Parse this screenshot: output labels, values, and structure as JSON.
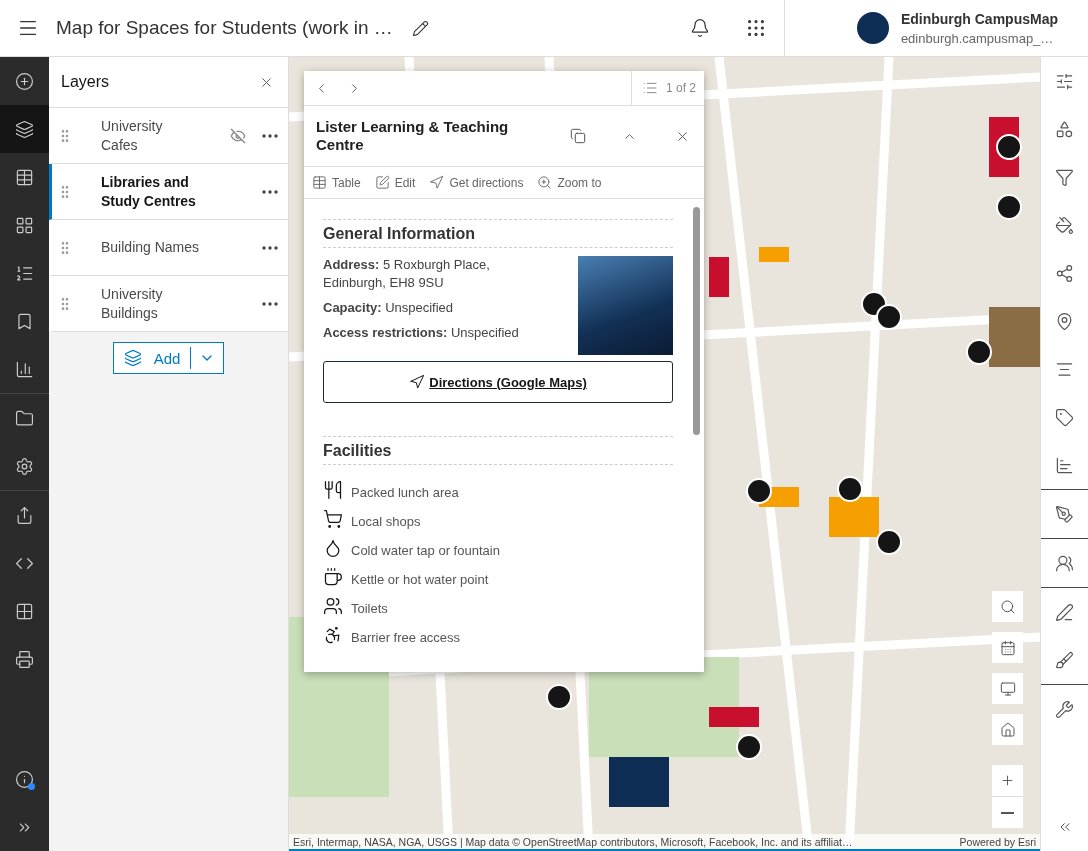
{
  "header": {
    "title": "Map for Spaces for Students (work in …",
    "org_name": "Edinburgh CampusMap",
    "org_url": "edinburgh.campusmap_…"
  },
  "left_rail": [
    {
      "selected": false
    },
    {
      "selected": true
    },
    {
      "selected": false
    },
    {
      "selected": false
    },
    {
      "selected": false
    },
    {
      "selected": false
    },
    {
      "selected": false
    },
    {
      "selected": false
    },
    {
      "selected": false
    },
    {
      "selected": false
    },
    {
      "selected": false
    },
    {
      "selected": false
    },
    {
      "selected": false
    }
  ],
  "layers_panel": {
    "title": "Layers",
    "layers": [
      {
        "name": "University Cafes",
        "selected": false,
        "hidden": true
      },
      {
        "name": "Libraries and Study Centres",
        "selected": true,
        "hidden": false
      },
      {
        "name": "Building Names",
        "selected": false,
        "hidden": false
      },
      {
        "name": "University Buildings",
        "selected": false,
        "hidden": false
      }
    ],
    "add_button": "Add"
  },
  "popup": {
    "pager": "1 of 2",
    "title": "Lister Learning & Teaching Centre",
    "actions": [
      "Table",
      "Edit",
      "Get directions",
      "Zoom to"
    ],
    "general_heading": "General Information",
    "fields": [
      {
        "label": "Address:",
        "value": "5 Roxburgh Place, Edinburgh, EH8 9SU"
      },
      {
        "label": "Capacity:",
        "value": "Unspecified"
      },
      {
        "label": "Access restrictions:",
        "value": "Unspecified"
      }
    ],
    "directions_link": "Directions (Google Maps)",
    "facilities_heading": "Facilities",
    "facilities": [
      "Packed lunch area",
      "Local shops",
      "Cold water tap or fountain",
      "Kettle or hot water point",
      "Toilets",
      "Barrier free access"
    ]
  },
  "attribution": "Esri, Intermap, NASA, NGA, USGS | Map data © OpenStreetMap contributors, Microsoft, Facebook, Inc. and its affiliat…",
  "powered_by": "Powered by Esri"
}
